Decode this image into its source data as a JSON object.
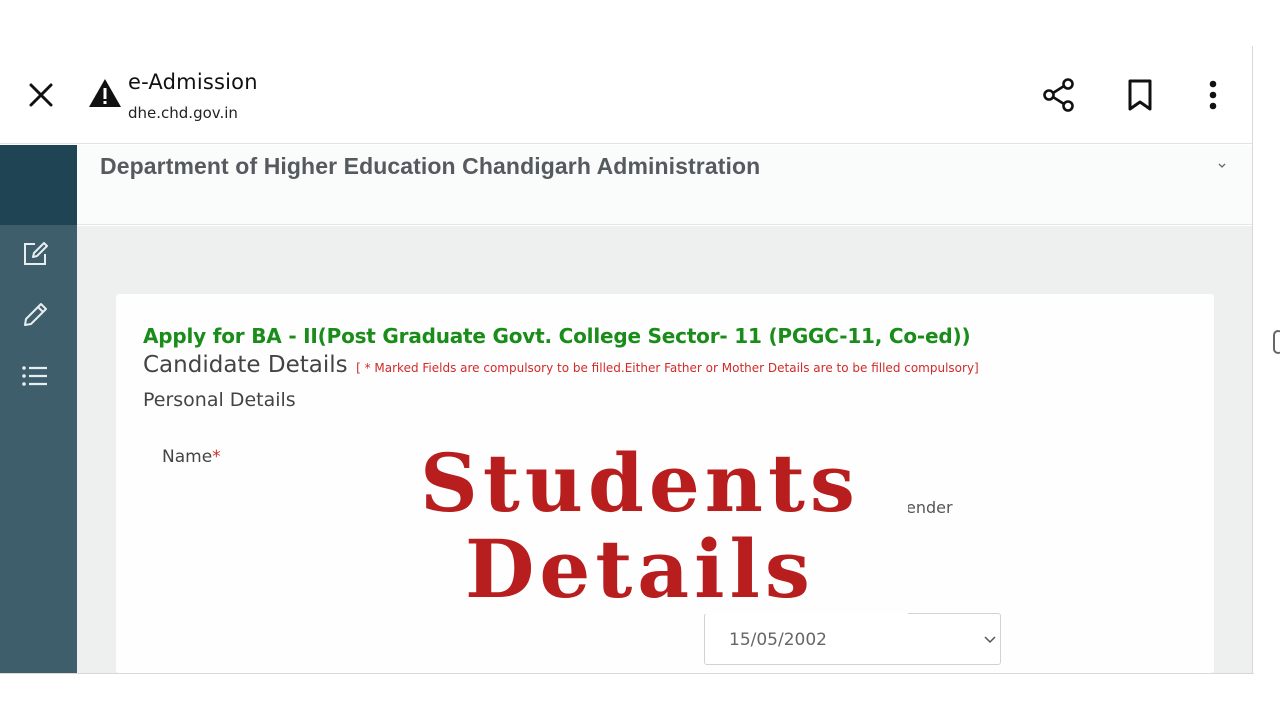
{
  "browser": {
    "site_title": "e-Admission",
    "site_url": "dhe.chd.gov.in",
    "icons": [
      "close-icon",
      "warning-icon",
      "share-icon",
      "bookmark-icon",
      "more-vertical-icon"
    ]
  },
  "header": {
    "title": "Department of Higher Education Chandigarh Administration"
  },
  "sidebar": {
    "items": [
      {
        "icon": "edit-square-icon"
      },
      {
        "icon": "pencil-icon"
      },
      {
        "icon": "list-icon"
      }
    ]
  },
  "form": {
    "apply_title": "Apply for BA - II(Post Graduate Govt. College Sector- 11 (PGGC-11, Co-ed))",
    "section_title": "Candidate Details",
    "note": "[ * Marked Fields are compulsory to be filled.Either Father or Mother Details are to be filled compulsory]",
    "subsection": "Personal Details",
    "name_label": "Name",
    "required_mark": "*",
    "gender_label": "ender",
    "dob_value": "15/05/2002"
  },
  "overlay": {
    "line1": "Students",
    "line2": "Details"
  },
  "colors": {
    "sidebar_dark": "#1f4454",
    "sidebar": "#3f5e6c",
    "apply_green": "#1a8c1a",
    "required_red": "#d22a2a",
    "overlay_red": "#b81e1e"
  }
}
